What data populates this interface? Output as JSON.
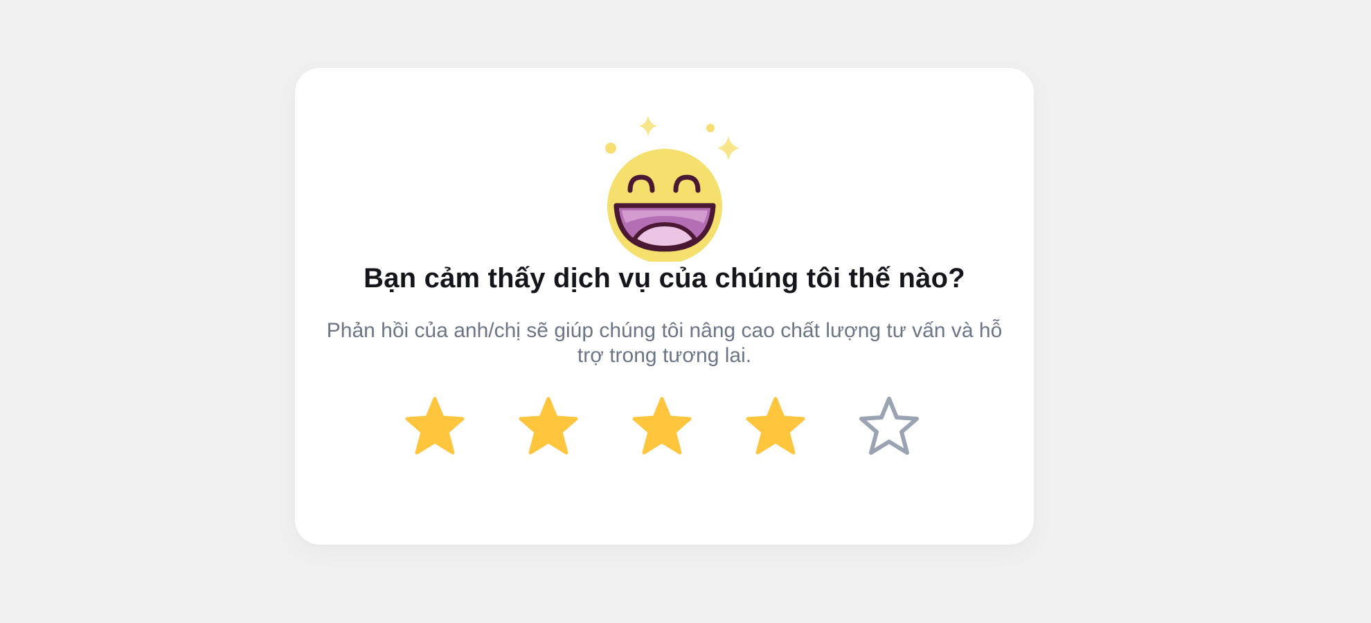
{
  "rating_card": {
    "title": "Bạn cảm thấy dịch vụ của chúng tôi thế nào?",
    "subtitle": "Phản hồi của anh/chị sẽ giúp chúng tôi nâng cao chất lượng tư vấn và hỗ trợ trong tương lai.",
    "emoji_icon": "laughing-face-icon",
    "rating": {
      "value": 4,
      "max": 5
    },
    "stars": [
      {
        "icon": "star-filled-icon",
        "filled": true
      },
      {
        "icon": "star-filled-icon",
        "filled": true
      },
      {
        "icon": "star-filled-icon",
        "filled": true
      },
      {
        "icon": "star-filled-icon",
        "filled": true
      },
      {
        "icon": "star-outline-icon",
        "filled": false
      }
    ],
    "colors": {
      "background": "#f0f0f0",
      "card": "#ffffff",
      "title": "#15161c",
      "subtitle": "#6b7585",
      "star_filled": "#ffc53d",
      "star_empty_stroke": "#9aa3b2",
      "emoji_face": "#f5df6d",
      "emoji_outline": "#4a1832",
      "sparkle": "#f8e58a"
    }
  }
}
